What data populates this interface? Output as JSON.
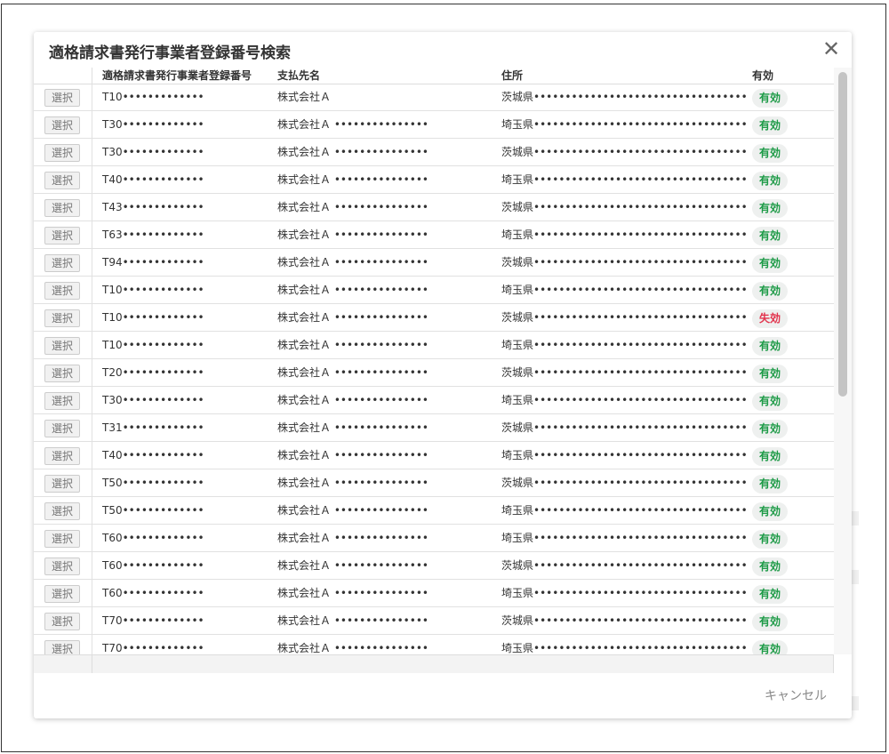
{
  "dialog": {
    "title": "適格請求書発行事業者登録番号検索",
    "close_label": "✕",
    "cancel_label": "キャンセル"
  },
  "table": {
    "headers": {
      "number": "適格請求書発行事業者登録番号",
      "payee": "支払先名",
      "address": "住所",
      "status": "有効"
    },
    "select_label": "選択",
    "rows": [
      {
        "number": "T10•••••••••••••",
        "payee": "株式会社Ａ",
        "address": "茨城県••••••••••••••••••••••••••••••••••",
        "status": "有効"
      },
      {
        "number": "T30•••••••••••••",
        "payee": "株式会社Ａ •••••••••••••••",
        "address": "埼玉県••••••••••••••••••••••••••••••••••",
        "status": "有効"
      },
      {
        "number": "T30•••••••••••••",
        "payee": "株式会社Ａ •••••••••••••••",
        "address": "茨城県••••••••••••••••••••••••••••••••••",
        "status": "有効"
      },
      {
        "number": "T40•••••••••••••",
        "payee": "株式会社Ａ •••••••••••••••",
        "address": "埼玉県••••••••••••••••••••••••••••••••••",
        "status": "有効"
      },
      {
        "number": "T43•••••••••••••",
        "payee": "株式会社Ａ •••••••••••••••",
        "address": "茨城県••••••••••••••••••••••••••••••••••",
        "status": "有効"
      },
      {
        "number": "T63•••••••••••••",
        "payee": "株式会社Ａ •••••••••••••••",
        "address": "埼玉県••••••••••••••••••••••••••••••••••",
        "status": "有効"
      },
      {
        "number": "T94•••••••••••••",
        "payee": "株式会社Ａ •••••••••••••••",
        "address": "茨城県••••••••••••••••••••••••••••••••••",
        "status": "有効"
      },
      {
        "number": "T10•••••••••••••",
        "payee": "株式会社Ａ •••••••••••••••",
        "address": "埼玉県••••••••••••••••••••••••••••••••••",
        "status": "有効"
      },
      {
        "number": "T10•••••••••••••",
        "payee": "株式会社Ａ •••••••••••••••",
        "address": "茨城県••••••••••••••••••••••••••••••••••",
        "status": "失効"
      },
      {
        "number": "T10•••••••••••••",
        "payee": "株式会社Ａ •••••••••••••••",
        "address": "埼玉県••••••••••••••••••••••••••••••••••",
        "status": "有効"
      },
      {
        "number": "T20•••••••••••••",
        "payee": "株式会社Ａ •••••••••••••••",
        "address": "茨城県••••••••••••••••••••••••••••••••••",
        "status": "有効"
      },
      {
        "number": "T30•••••••••••••",
        "payee": "株式会社Ａ •••••••••••••••",
        "address": "埼玉県••••••••••••••••••••••••••••••••••",
        "status": "有効"
      },
      {
        "number": "T31•••••••••••••",
        "payee": "株式会社Ａ •••••••••••••••",
        "address": "茨城県••••••••••••••••••••••••••••••••••",
        "status": "有効"
      },
      {
        "number": "T40•••••••••••••",
        "payee": "株式会社Ａ •••••••••••••••",
        "address": "埼玉県••••••••••••••••••••••••••••••••••",
        "status": "有効"
      },
      {
        "number": "T50•••••••••••••",
        "payee": "株式会社Ａ •••••••••••••••",
        "address": "茨城県••••••••••••••••••••••••••••••••••",
        "status": "有効"
      },
      {
        "number": "T50•••••••••••••",
        "payee": "株式会社Ａ •••••••••••••••",
        "address": "埼玉県••••••••••••••••••••••••••••••••••",
        "status": "有効"
      },
      {
        "number": "T60•••••••••••••",
        "payee": "株式会社Ａ •••••••••••••••",
        "address": "埼玉県••••••••••••••••••••••••••••••••••",
        "status": "有効"
      },
      {
        "number": "T60•••••••••••••",
        "payee": "株式会社Ａ •••••••••••••••",
        "address": "茨城県••••••••••••••••••••••••••••••••••",
        "status": "有効"
      },
      {
        "number": "T60•••••••••••••",
        "payee": "株式会社Ａ •••••••••••••••",
        "address": "埼玉県••••••••••••••••••••••••••••••••••",
        "status": "有効"
      },
      {
        "number": "T70•••••••••••••",
        "payee": "株式会社Ａ •••••••••••••••",
        "address": "茨城県••••••••••••••••••••••••••••••••••",
        "status": "有効"
      },
      {
        "number": "T70•••••••••••••",
        "payee": "株式会社Ａ •••••••••••••••",
        "address": "埼玉県••••••••••••••••••••••••••••••••••",
        "status": "有効"
      }
    ]
  },
  "colors": {
    "valid": "#1c9a46",
    "invalid": "#e2314b"
  }
}
